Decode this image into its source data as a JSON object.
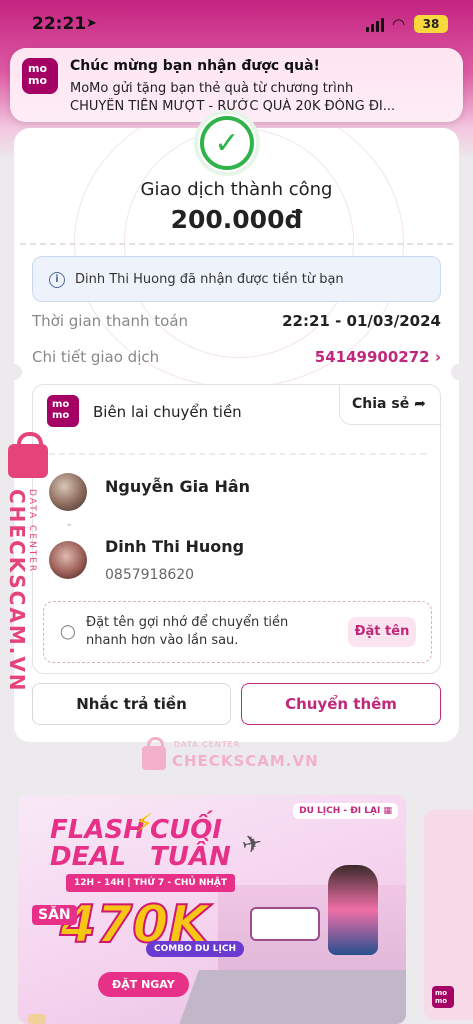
{
  "status_bar": {
    "time": "22:21",
    "battery": "38"
  },
  "notification": {
    "app_logo": "mo\nmo",
    "title": "Chúc mừng bạn nhận được quà!",
    "line1": "MoMo gửi tặng bạn thẻ quà từ chương trình",
    "line2": "CHUYỂN TIỀN MƯỢT - RƯỚC QUÀ 20K ĐÓNG ĐI..."
  },
  "transaction": {
    "status": "Giao dịch thành công",
    "amount": "200.000đ",
    "info": "Dinh Thi Huong đã nhận được tiền từ bạn",
    "time_label": "Thời gian thanh toán",
    "time_value": "22:21 - 01/03/2024",
    "detail_label": "Chi tiết giao dịch",
    "detail_value": "54149900272"
  },
  "receipt": {
    "logo": "mo\nmo",
    "title": "Biên lai chuyển tiền",
    "share_label": "Chia sẻ",
    "sender_name": "Nguyễn Gia Hân",
    "recipient_name": "Dinh Thi Huong",
    "recipient_phone": "0857918620",
    "hint_text": "Đặt tên gợi nhớ để chuyển tiền nhanh hơn vào lần sau.",
    "hint_button": "Đặt tên"
  },
  "actions": {
    "remind_label": "Nhắc trả tiền",
    "transfer_more_label": "Chuyển thêm"
  },
  "watermark": {
    "brand": "CHECKSCAM.VN",
    "sub": "DATA CENTER"
  },
  "banner": {
    "tag": "DU LỊCH - ĐI LẠI",
    "flash": "FLASH",
    "deal": "DEAL",
    "cuoi": "CUỐI",
    "tuan": "TUẦN",
    "hours": "12H - 14H | THỨ 7 - CHỦ NHẬT",
    "san": "SĂN",
    "big": "470K",
    "combo": "COMBO DU LỊCH",
    "cta": "ĐẶT NGAY"
  },
  "colors": {
    "brand": "#a50064",
    "accent": "#c0287c",
    "success": "#2fb34a",
    "watermark": "#e5447a"
  }
}
